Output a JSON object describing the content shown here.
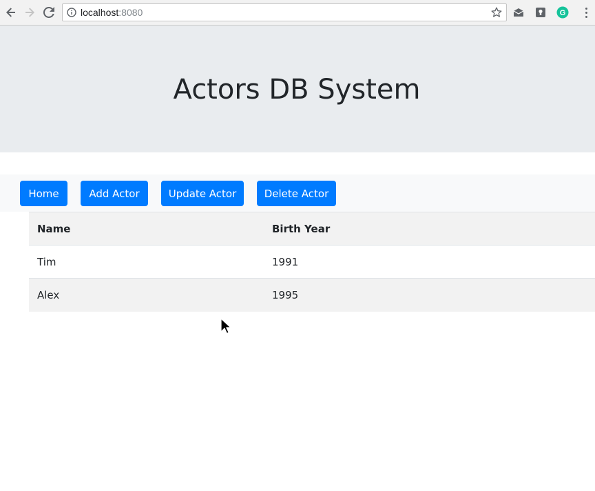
{
  "browser": {
    "url_host": "localhost",
    "url_port": ":8080",
    "icons": [
      "back-arrow-icon",
      "forward-arrow-icon",
      "reload-icon",
      "info-icon",
      "star-icon",
      "mail-extension-icon",
      "keep-extension-icon",
      "grammarly-icon",
      "menu-dots-icon"
    ],
    "colors": {
      "chrome_bg": "#f2f2f2",
      "grammarly": "#15c39a"
    }
  },
  "header": {
    "title": "Actors DB System",
    "bg": "#e9ecef"
  },
  "nav": {
    "buttons": [
      {
        "label": "Home"
      },
      {
        "label": "Add Actor"
      },
      {
        "label": "Update Actor"
      },
      {
        "label": "Delete Actor"
      }
    ],
    "button_color": "#007bff"
  },
  "table": {
    "columns": [
      "Name",
      "Birth Year"
    ],
    "rows": [
      [
        "Tim",
        "1991"
      ],
      [
        "Alex",
        "1995"
      ]
    ],
    "stripe_color": "#f2f2f2"
  }
}
